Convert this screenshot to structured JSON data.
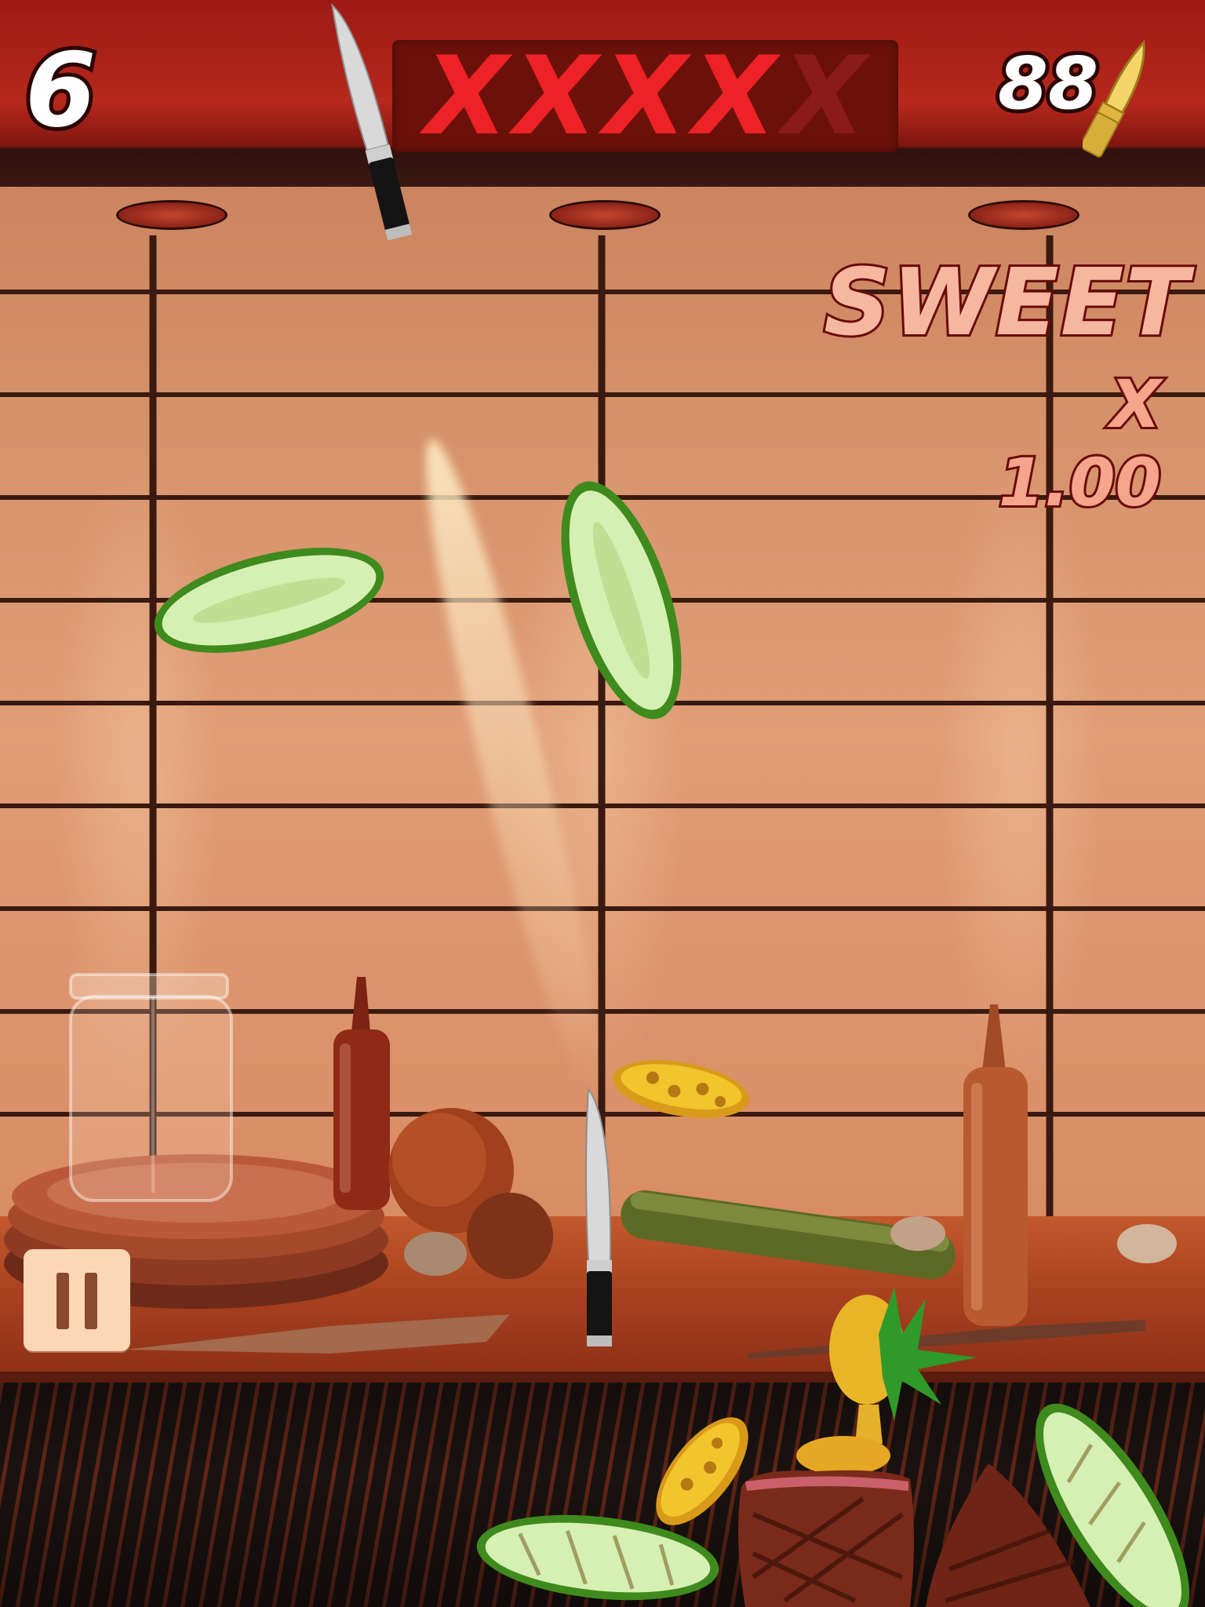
{
  "hud": {
    "score": "6",
    "strikes": [
      {
        "mark": "X",
        "active": true
      },
      {
        "mark": "X",
        "active": true
      },
      {
        "mark": "X",
        "active": true
      },
      {
        "mark": "X",
        "active": true
      },
      {
        "mark": "X",
        "active": false
      }
    ],
    "knives_remaining": "88",
    "knife_icon": "golden-knife-icon"
  },
  "combo": {
    "word": "SWEET",
    "multiplier": "X 1.00"
  },
  "controls": {
    "pause_icon": "pause-icon"
  },
  "colors": {
    "strike_active": "#ec2227",
    "strike_inactive": "#8b1a1a",
    "hood_red": "#b6281c",
    "pause_button_bg": "#fcd7b5"
  }
}
